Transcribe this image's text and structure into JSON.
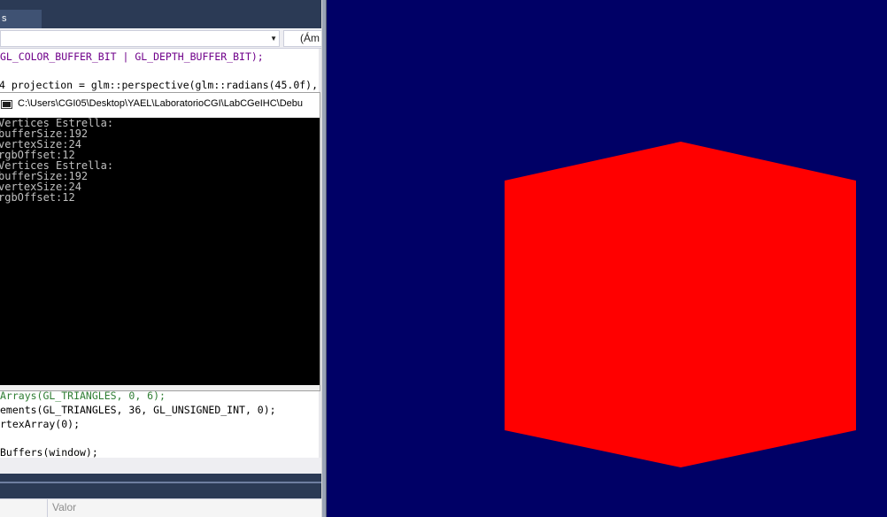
{
  "editor": {
    "tab_label": "s",
    "nav_scope": "(Ám",
    "nav_dropdown_icon": "chevron-down-icon",
    "code_lines": [
      {
        "pre": "GL_COLOR_BUFFER_BIT | GL_DEPTH_BUFFER_BIT);"
      },
      {
        "pre": "4 projection = glm::perspective(glm::radians(45.0f), "
      },
      {
        "pre": "Arrays(GL_TRIANGLES, 0, 6);"
      },
      {
        "pre": "ements(GL_TRIANGLES, 36, GL_UNSIGNED_INT, 0);"
      },
      {
        "pre": "rtexArray(0);"
      },
      {
        "pre": "Buffers(window);"
      }
    ],
    "locals_column": "Valor"
  },
  "console": {
    "title": "C:\\Users\\CGI05\\Desktop\\YAEL\\LaboratorioCGI\\LabCGeIHC\\Debu",
    "lines": [
      "Vertices Estrella:",
      "bufferSize:192",
      "vertexSize:24",
      "rgbOffset:12",
      "Vertices Estrella:",
      "bufferSize:192",
      "vertexSize:24",
      "rgbOffset:12"
    ]
  },
  "render": {
    "background_color": "#000066",
    "cube_color": "#ff0000",
    "shape": "red-cube"
  }
}
